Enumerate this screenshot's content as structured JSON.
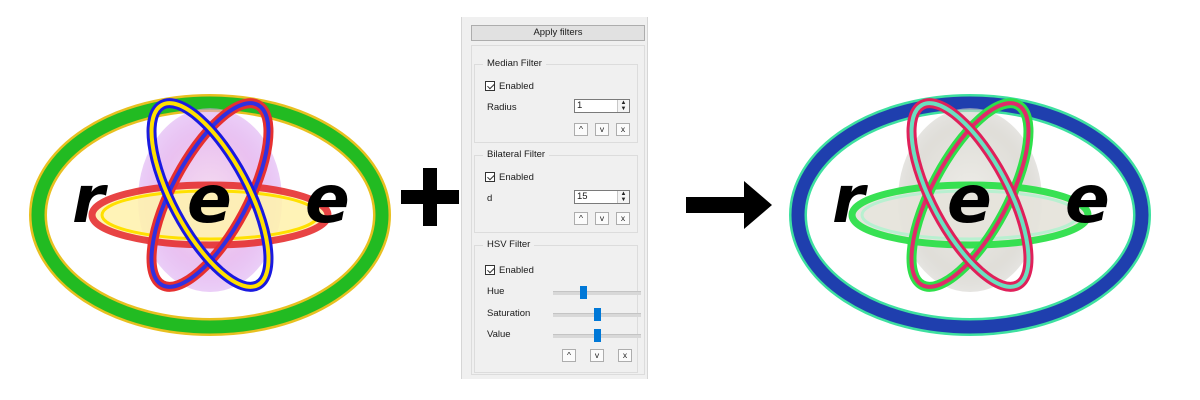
{
  "images": {
    "input_logo": {
      "letters": [
        "r",
        "e",
        "e"
      ]
    },
    "output_logo": {
      "letters": [
        "r",
        "e",
        "e"
      ]
    },
    "operator_plus": "+",
    "arrow_icon": "arrow-right-icon"
  },
  "panel": {
    "apply_button": "Apply filters",
    "median": {
      "title": "Median Filter",
      "enabled_label": "Enabled",
      "enabled": true,
      "param_label": "Radius",
      "param_value": "1",
      "buttons": [
        "^",
        "v",
        "x"
      ]
    },
    "bilateral": {
      "title": "Bilateral Filter",
      "enabled_label": "Enabled",
      "enabled": true,
      "param_label": "d",
      "param_value": "15",
      "buttons": [
        "^",
        "v",
        "x"
      ]
    },
    "hsv": {
      "title": "HSV Filter",
      "enabled_label": "Enabled",
      "enabled": true,
      "sliders": [
        {
          "label": "Hue",
          "value_fraction": 0.33
        },
        {
          "label": "Saturation",
          "value_fraction": 0.5
        },
        {
          "label": "Value",
          "value_fraction": 0.5
        }
      ],
      "buttons": [
        "^",
        "v",
        "x"
      ]
    }
  },
  "colors": {
    "input_ring": "#22bb22",
    "input_ring_border": "#e8c020",
    "output_ring": "#1f3fae",
    "output_ring_border": "#3ee0a0",
    "slider_accent": "#0078d7"
  }
}
